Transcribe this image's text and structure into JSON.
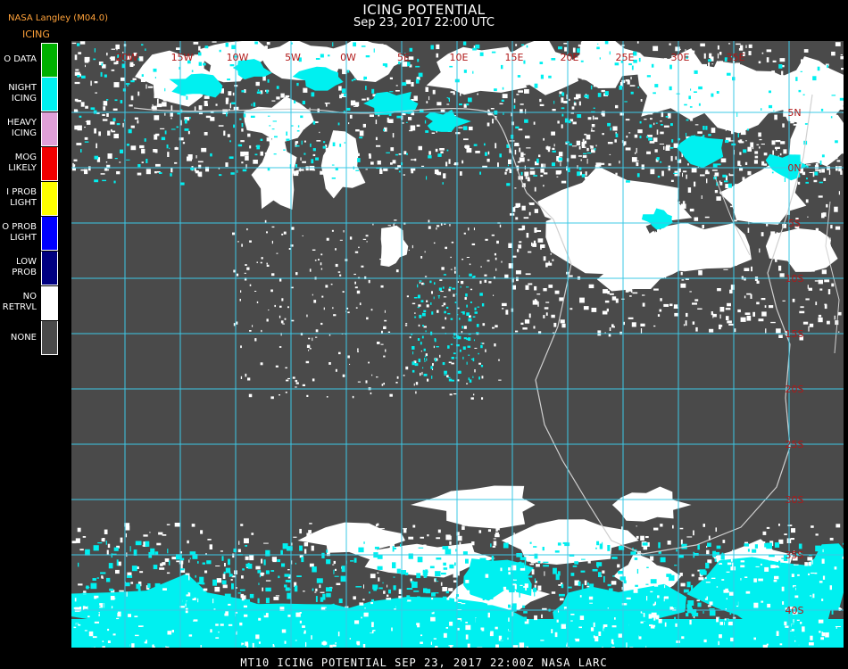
{
  "header": {
    "producer": "NASA Langley (M04.0)",
    "title": "ICING POTENTIAL",
    "subtitle": "Sep 23, 2017 22:00 UTC"
  },
  "legend": {
    "heading": "ICING",
    "items": [
      {
        "label": "O DATA",
        "color": "#00b000"
      },
      {
        "label": "NIGHT\nICING",
        "color": "#00f0f0"
      },
      {
        "label": "HEAVY\nICING",
        "color": "#e0a0d8"
      },
      {
        "label": "MOG\nLIKELY",
        "color": "#f00000"
      },
      {
        "label": "I PROB\nLIGHT",
        "color": "#ffff00"
      },
      {
        "label": "O PROB\nLIGHT",
        "color": "#0000ff"
      },
      {
        "label": "LOW\nPROB",
        "color": "#000080"
      },
      {
        "label": "NO\nRETRVL",
        "color": "#ffffff"
      },
      {
        "label": "NONE",
        "color": "#4a4a4a"
      }
    ]
  },
  "map": {
    "background": "#4a4a4a",
    "grid_color": "#3cc8e6",
    "coast_color": "#d0d0d0",
    "cloud_color": "#ffffff",
    "icing_color": "#00f0f0",
    "label_color": "#b01818",
    "lon_labels": [
      "20W",
      "15W",
      "10W",
      "5W",
      "0W",
      "5E",
      "10E",
      "15E",
      "20E",
      "25E",
      "30E",
      "35E"
    ],
    "lat_labels": [
      "5N",
      "0N",
      "5S",
      "10S",
      "15S",
      "20S",
      "25S",
      "30S",
      "35S",
      "40S"
    ]
  },
  "footer": {
    "text": "MT10  ICING POTENTIAL   SEP 23, 2017 22:00Z   NASA LARC"
  }
}
